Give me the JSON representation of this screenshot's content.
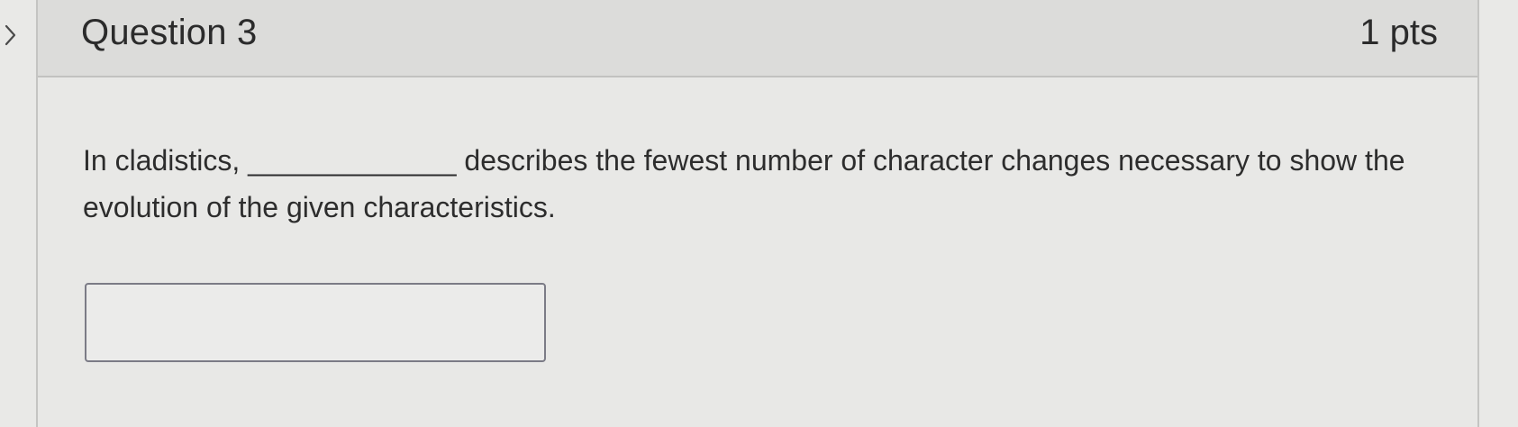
{
  "question": {
    "title": "Question 3",
    "points": "1 pts",
    "text": "In cladistics, _____________ describes the fewest number of character changes necessary to show the evolution of the given characteristics.",
    "answer_value": ""
  },
  "icons": {
    "expand": "chevron-right-icon"
  }
}
